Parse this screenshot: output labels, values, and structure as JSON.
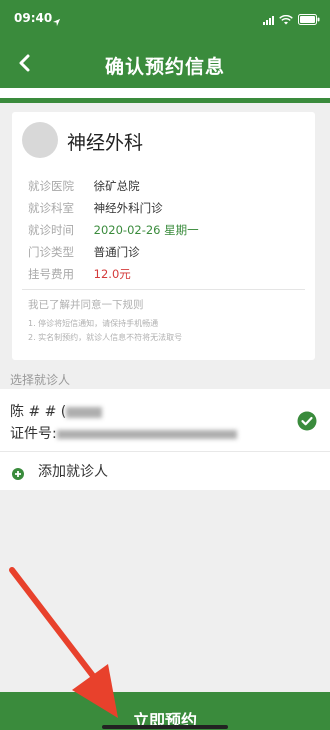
{
  "status_bar": {
    "time": "09:40"
  },
  "header": {
    "title": "确认预约信息"
  },
  "department": {
    "name": "神经外科"
  },
  "appointment": {
    "rows": [
      {
        "label": "就诊医院",
        "value": "徐矿总院"
      },
      {
        "label": "就诊科室",
        "value": "神经外科门诊"
      },
      {
        "label": "就诊时间",
        "value": "2020-02-26 星期一"
      },
      {
        "label": "门诊类型",
        "value": "普通门诊"
      },
      {
        "label": "挂号费用",
        "value": "12.0元"
      }
    ]
  },
  "rules": {
    "title": "我已了解并同意一下规则",
    "items": [
      "1. 停诊将短信通知，请保持手机畅通",
      "2. 实名制预约，就诊人信息不符将无法取号"
    ]
  },
  "patient_section": {
    "title": "选择就诊人",
    "name_prefix": "陈 # # (",
    "id_label": "证件号:",
    "add_label": "添加就诊人"
  },
  "footer": {
    "submit_label": "立即预约"
  },
  "colors": {
    "primary": "#3a8b3c",
    "price": "#d43a3a",
    "arrow": "#e8412c"
  }
}
